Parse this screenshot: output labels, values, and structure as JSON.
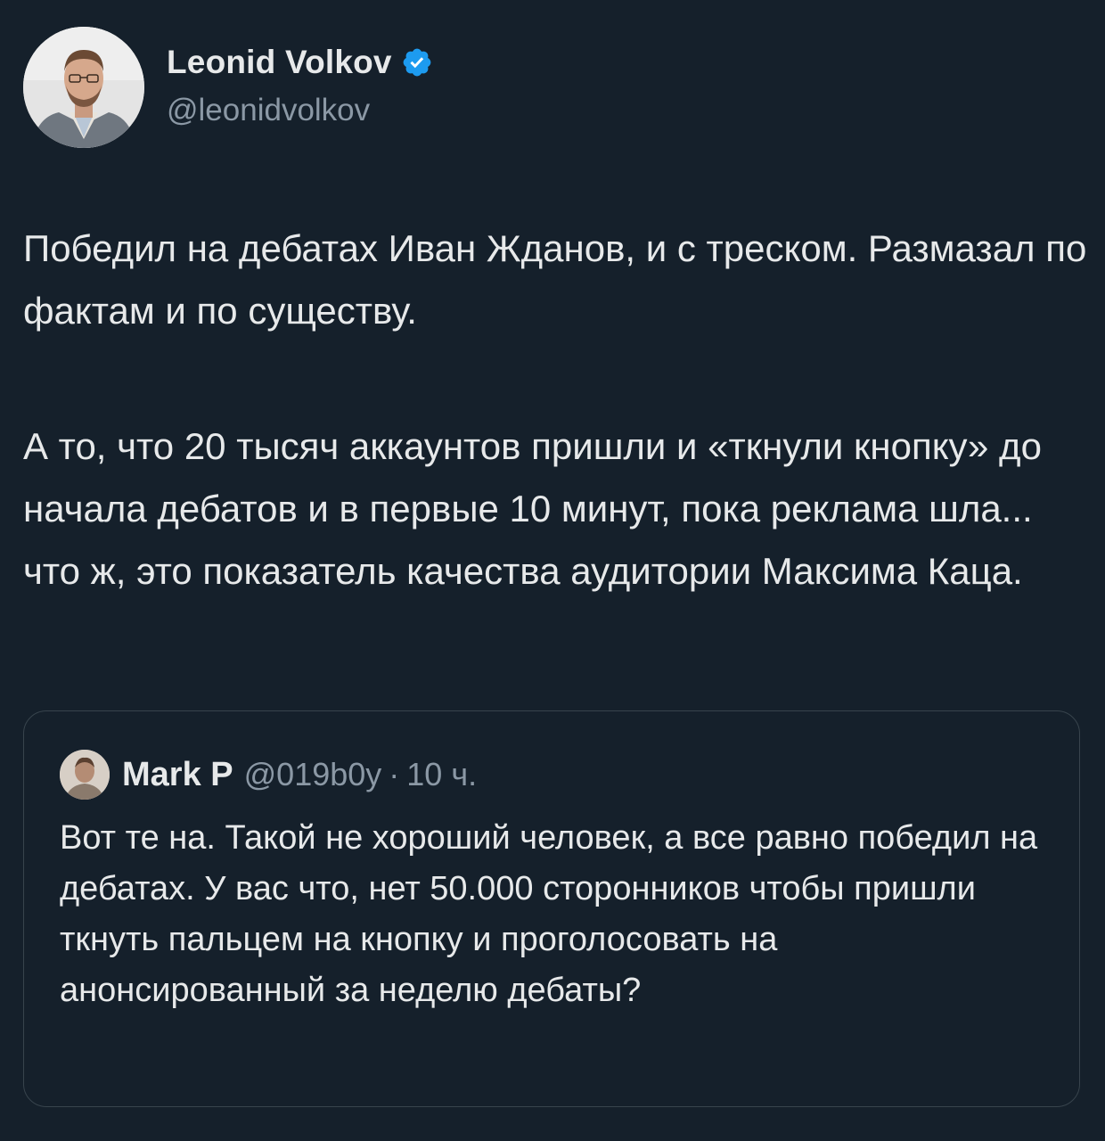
{
  "author": {
    "display_name": "Leonid Volkov",
    "handle": "@leonidvolkov",
    "avatar_icon": "person-photo",
    "verified_icon": "verified-badge-icon",
    "verified_color": "#1d9bf0"
  },
  "tweet": {
    "paragraph_1": "Победил на дебатах Иван Жданов, и с треском. Размазал по фактам и по существу.",
    "paragraph_2": "А то, что 20 тысяч аккаунтов пришли и «ткнули кнопку» до начала дебатов и в первые 10 минут, пока реклама шла... что ж, это показатель качества аудитории Максима Каца."
  },
  "quote": {
    "display_name": "Mark P",
    "handle": "@019b0y",
    "separator": "·",
    "time": "10 ч.",
    "avatar_icon": "person-photo",
    "text": "Вот те на. Такой не хороший человек, а все равно победил на дебатах. У вас что, нет 50.000 сторонников чтобы пришли ткнуть пальцем на кнопку и проголосовать на анонсированный за неделю дебаты?"
  },
  "colors": {
    "background": "#15202b",
    "text_primary": "#e7e9ea",
    "text_secondary": "#8b98a5",
    "border": "#38444d",
    "accent": "#1d9bf0"
  }
}
